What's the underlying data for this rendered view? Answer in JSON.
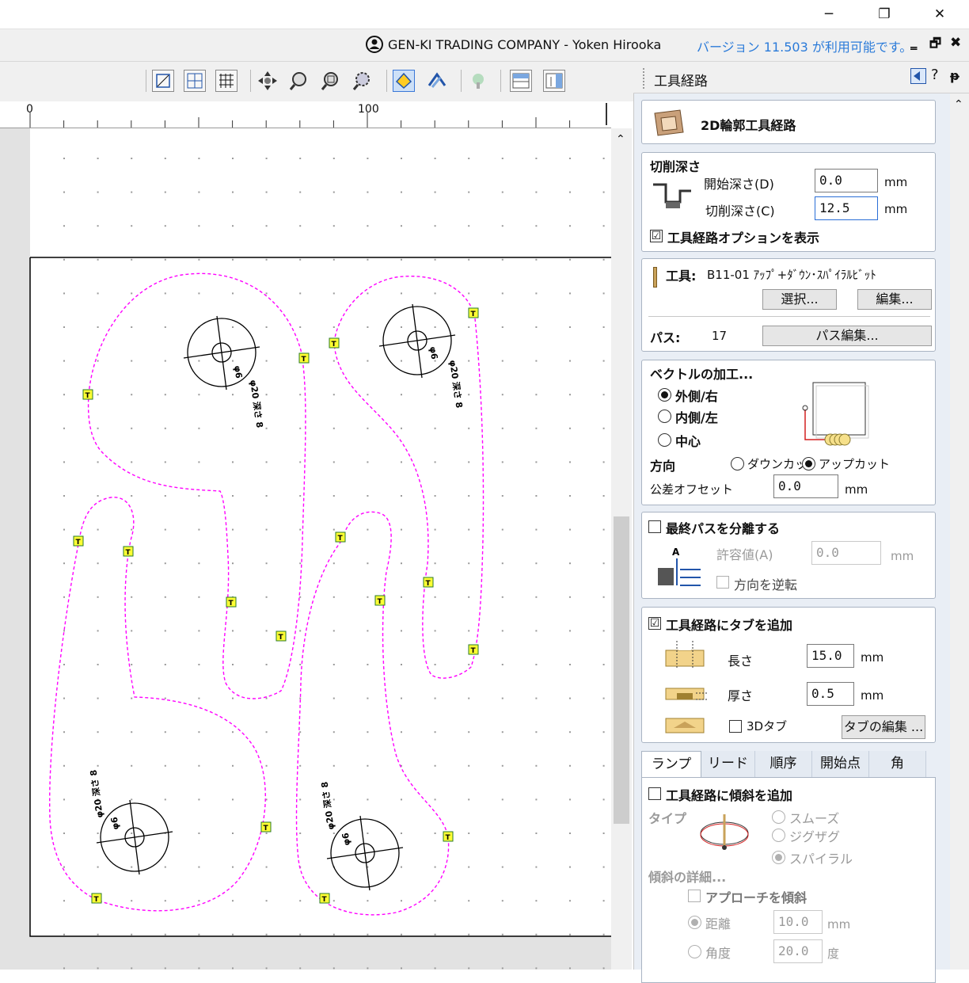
{
  "window": {
    "company": "GEN-KI TRADING COMPANY - Yoken Hirooka",
    "version_notice": "バージョン 11.503 が利用可能です。",
    "minimize": "─",
    "restore": "❐",
    "close": "✕",
    "mdi_minimize": "‗",
    "mdi_restore": "🗗",
    "mdi_close": "✖"
  },
  "ruler": {
    "labels": [
      "0",
      "100"
    ]
  },
  "panel": {
    "title": "工具経路",
    "help": "?",
    "pin": "ᵽ",
    "header": "2D輪郭工具経路",
    "cut_depth": {
      "title": "切削深さ",
      "start_label": "開始深さ(D)",
      "start_value": "0.0",
      "cut_label": "切削深さ(C)",
      "cut_value": "12.5",
      "unit": "mm"
    },
    "show_options": {
      "label": "工具経路オプションを表示",
      "checked": "☑"
    },
    "tool": {
      "label": "工具:",
      "name": "B11-01 ｱｯﾌﾟ+ﾀﾞｳﾝ･ｽﾊﾟｲﾗﾙﾋﾞｯﾄ",
      "select_button": "選択...",
      "edit_button": "編集...",
      "passes_label": "パス:",
      "passes_value": "17",
      "pass_edit_button": "パス編集..."
    },
    "vector": {
      "title": "ベクトルの加工...",
      "outside": "外側/右",
      "inside": "内側/左",
      "center": "中心",
      "direction_label": "方向",
      "down_cut": "ダウンカッ",
      "up_cut": "アップカット",
      "tolerance_label": "公差オフセット",
      "tolerance_value": "0.0",
      "unit": "mm"
    },
    "final_pass": {
      "label": "最終パスを分離する",
      "allowance_label": "許容値(A)",
      "allowance_value": "0.0",
      "unit": "mm",
      "reverse_label": "方向を逆転",
      "icon_letter": "A"
    },
    "tabs_section": {
      "label": "工具経路にタブを追加",
      "checked": "☑",
      "length_label": "長さ",
      "length_value": "15.0",
      "thickness_label": "厚さ",
      "thickness_value": "0.5",
      "unit": "mm",
      "tab3d_label": "3Dタブ",
      "edit_tabs_button": "タブの編集 ..."
    },
    "tab_strip": [
      "ランプ",
      "リード",
      "順序",
      "開始点",
      "角"
    ],
    "ramp": {
      "label": "工具経路に傾斜を追加",
      "type_label": "タイプ",
      "smooth": "スムーズ",
      "zigzag": "ジグザグ",
      "spiral": "スパイラル",
      "details_label": "傾斜の詳細...",
      "approach_label": "アプローチを傾斜",
      "distance_label": "距離",
      "distance_value": "10.0",
      "distance_unit": "mm",
      "angle_label": "角度",
      "angle_value": "20.0",
      "angle_unit": "度"
    }
  },
  "drawing": {
    "hole_labels": [
      "φ6",
      "φ20 深さ 8"
    ],
    "tab_marker": "T"
  },
  "colors": {
    "toolpath": "#ff00ff",
    "tab_fill": "#ffff33",
    "accent_link": "#2b7bd9"
  }
}
